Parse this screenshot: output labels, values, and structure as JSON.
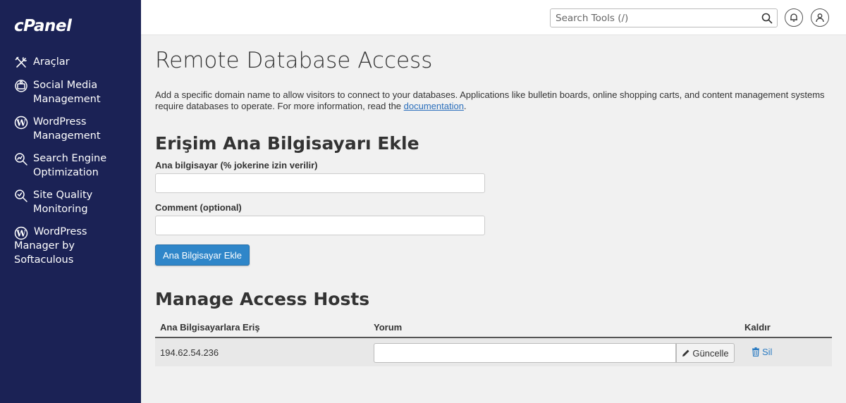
{
  "brand": {
    "logo_text": "cPanel"
  },
  "sidebar": {
    "items": [
      {
        "label": "Araçlar",
        "icon": "tools-icon"
      },
      {
        "label": "Social Media Management",
        "icon": "social-media-icon"
      },
      {
        "label": "WordPress Management",
        "icon": "wordpress-icon"
      },
      {
        "label": "Search Engine Optimization",
        "icon": "seo-icon"
      },
      {
        "label": "Site Quality Monitoring",
        "icon": "site-quality-icon"
      },
      {
        "label": "WordPress Manager by Softaculous",
        "icon": "wordpress-icon"
      }
    ]
  },
  "topbar": {
    "search_placeholder": "Search Tools (/)",
    "search_icon": "search-icon",
    "notifications_icon": "bell-icon",
    "user_icon": "user-icon"
  },
  "page": {
    "title": "Remote Database Access",
    "description_before": "Add a specific domain name to allow visitors to connect to your databases. Applications like bulletin boards, online shopping carts, and content management systems require databases to operate. For more information, read the ",
    "description_link": "documentation",
    "description_after": "."
  },
  "add_host": {
    "heading": "Erişim Ana Bilgisayarı Ekle",
    "host_label": "Ana bilgisayar (% jokerine izin verilir)",
    "host_value": "",
    "comment_label": "Comment (optional)",
    "comment_value": "",
    "submit_label": "Ana Bilgisayar Ekle"
  },
  "manage": {
    "heading": "Manage Access Hosts",
    "columns": [
      "Ana Bilgisayarlara Eriş",
      "Yorum",
      "Kaldır"
    ],
    "rows": [
      {
        "host": "194.62.54.236",
        "comment": "",
        "update_label": "Güncelle",
        "delete_label": "Sil"
      }
    ]
  },
  "colors": {
    "sidebar_bg": "#1b2255",
    "primary_button": "#2f86c9",
    "link": "#2a7bc2"
  }
}
